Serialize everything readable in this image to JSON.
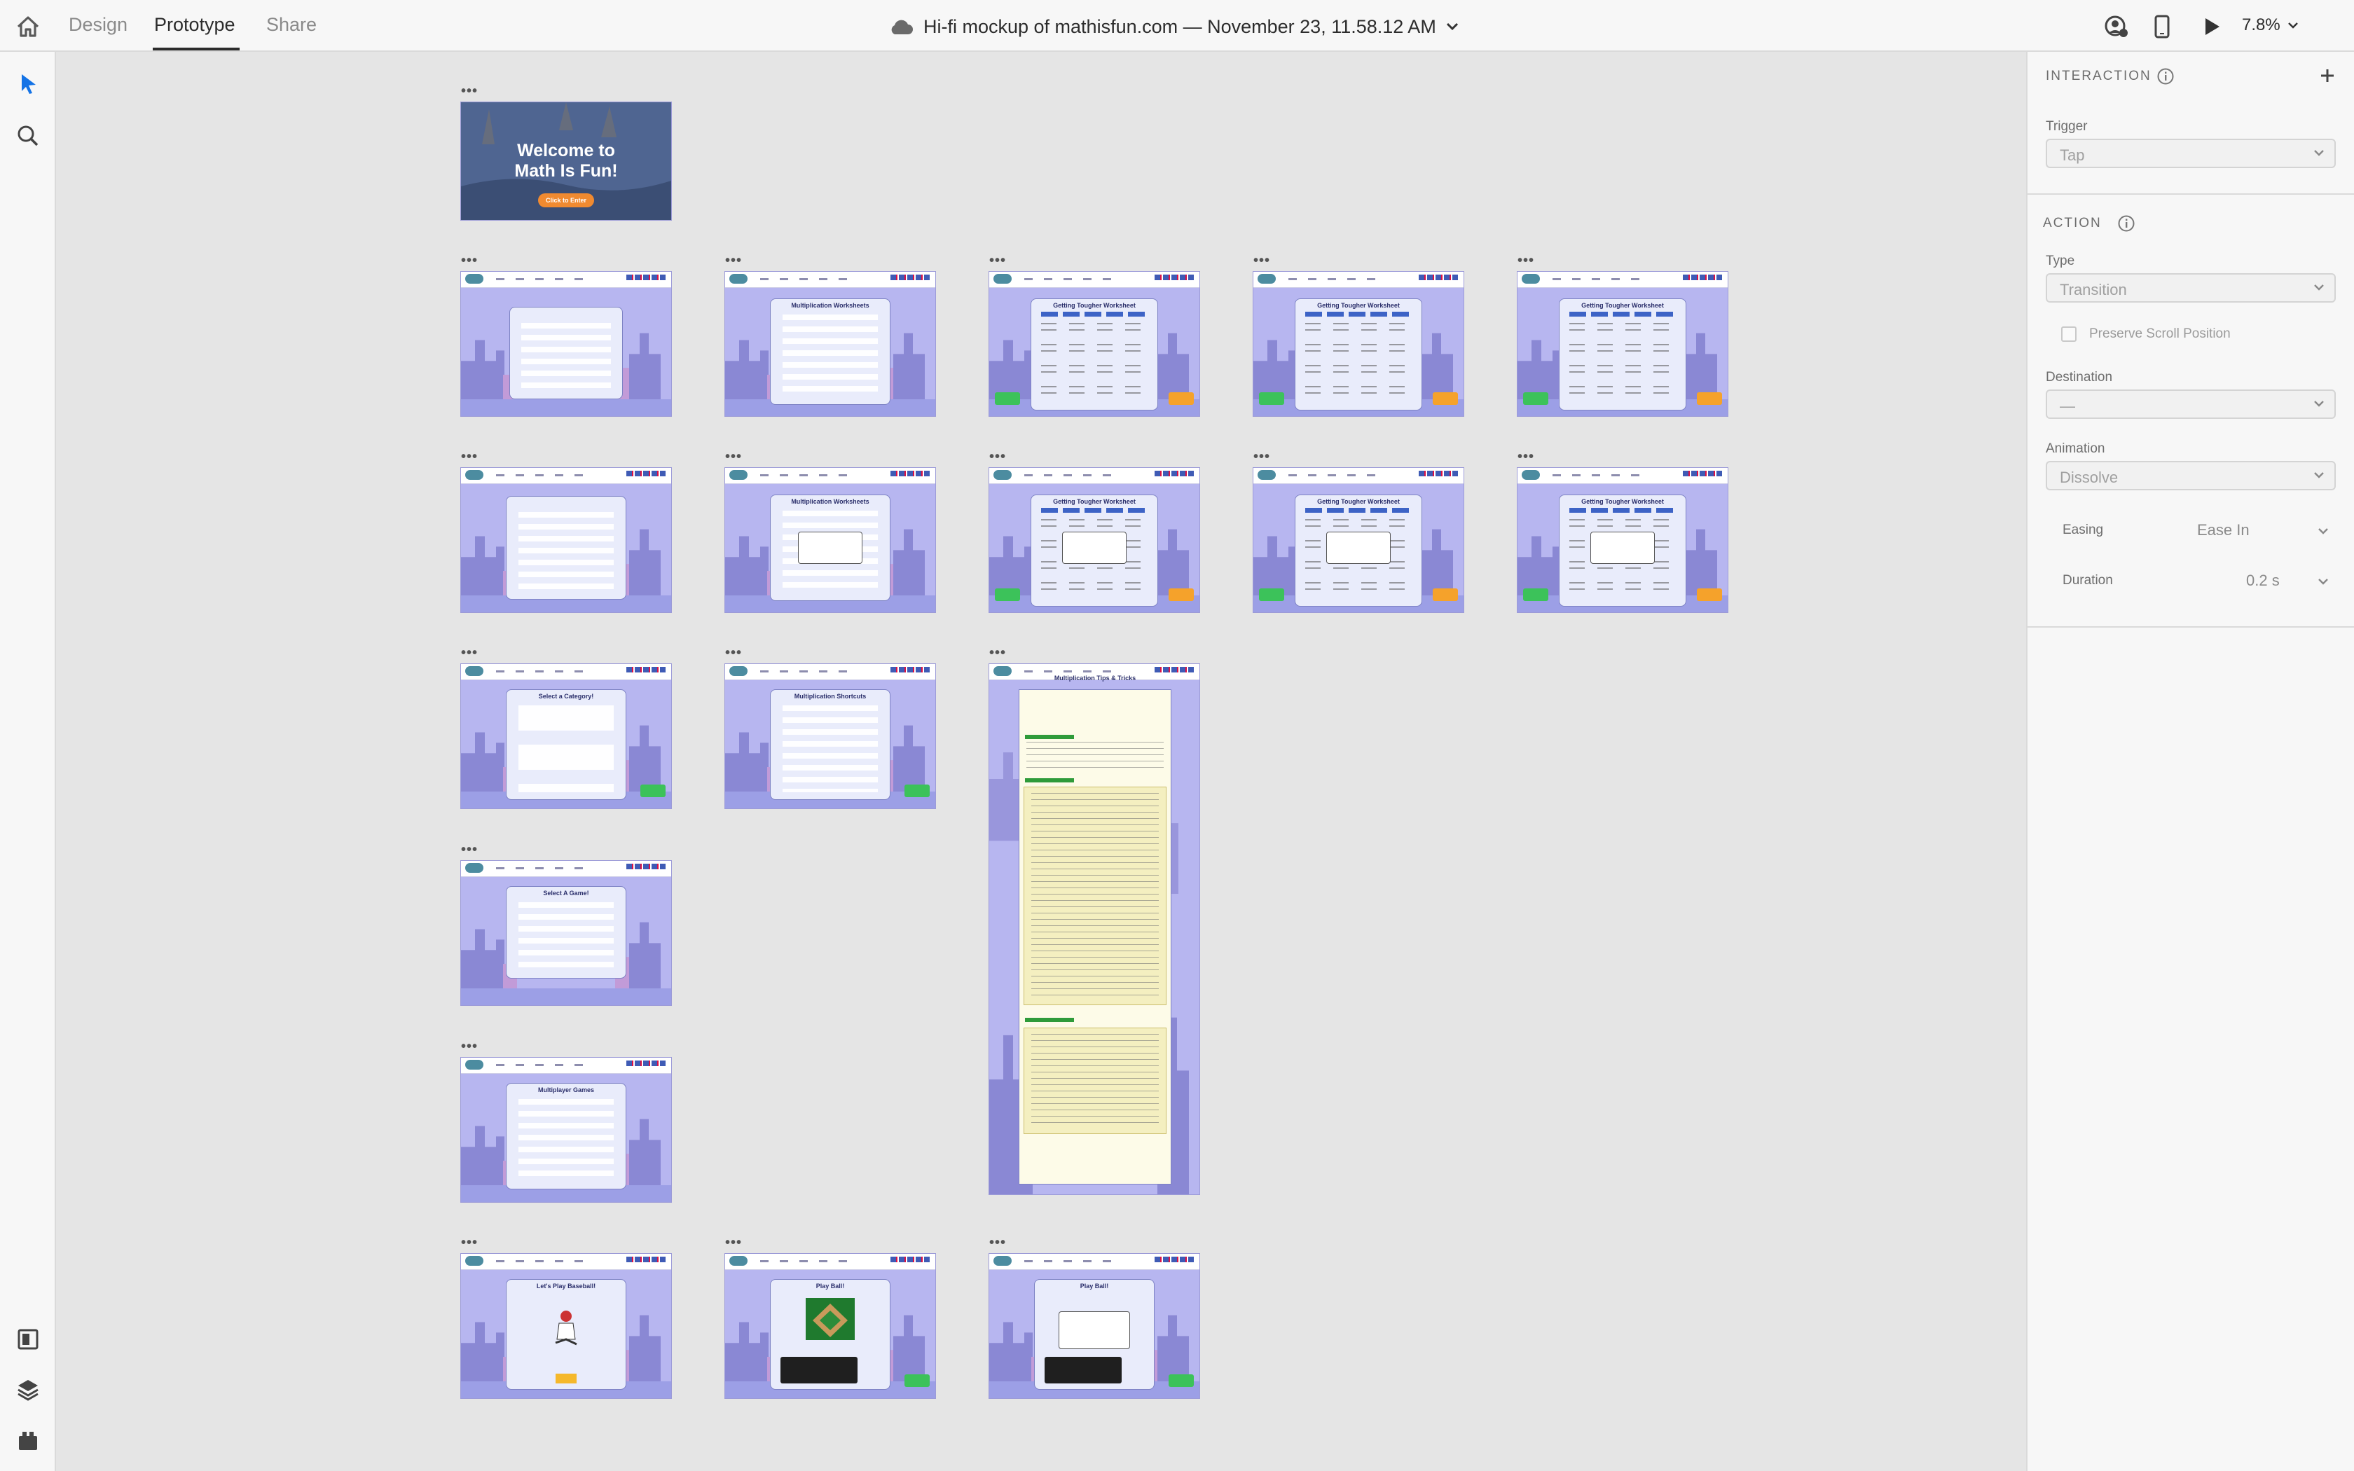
{
  "header": {
    "tabs": [
      {
        "label": "Design",
        "active": false
      },
      {
        "label": "Prototype",
        "active": true
      },
      {
        "label": "Share",
        "active": false
      }
    ],
    "doc_title": "Hi-fi mockup of mathisfun.com — November 23, 11.58.12 AM",
    "zoom": "7.8%",
    "icons": [
      "home-icon",
      "cloud-icon",
      "chevron-down-icon",
      "user-share-icon",
      "phone-icon",
      "play-icon"
    ]
  },
  "left_tools": [
    "select-arrow-icon",
    "search-icon",
    "assets-icon",
    "layers-icon",
    "plugins-icon"
  ],
  "canvas": {
    "welcome": {
      "title": "Welcome to Math Is Fun!",
      "line1": "Welcome to",
      "line2": "Math Is Fun!",
      "button": "Click to Enter"
    },
    "artboard_titles": {
      "mult_worksheets": "Multiplication Worksheets",
      "tougher": "Getting Tougher Worksheet",
      "select_category": "Select a Category!",
      "mult_shortcuts": "Multiplication Shortcuts",
      "tips_tricks": "Multiplication Tips & Tricks",
      "select_game": "Select A Game!",
      "multiplayer": "Multiplayer Games",
      "baseball": "Let's Play Baseball!",
      "play_ball": "Play Ball!"
    }
  },
  "interaction": {
    "section": "INTERACTION",
    "trigger_label": "Trigger",
    "trigger_value": "Tap",
    "action_section": "ACTION",
    "type_label": "Type",
    "type_value": "Transition",
    "preserve_scroll": "Preserve Scroll Position",
    "preserve_scroll_checked": false,
    "destination_label": "Destination",
    "destination_value": "—",
    "animation_label": "Animation",
    "animation_value": "Dissolve",
    "easing_label": "Easing",
    "easing_value": "Ease In",
    "duration_label": "Duration",
    "duration_value": "0.2 s"
  },
  "colors": {
    "artboard_bg": "#b7b6f0",
    "panel_bg": "#e9ecfb",
    "accent_green": "#3cc25a",
    "accent_orange": "#f5a22b",
    "select_blue": "#1473e6"
  }
}
